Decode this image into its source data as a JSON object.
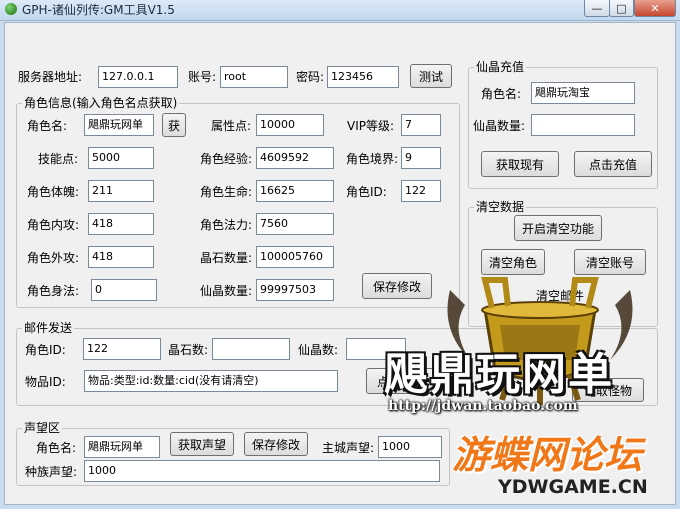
{
  "window": {
    "title": "GPH-诸仙列传:GM工具V1.5",
    "min": "—",
    "max": "□",
    "close": "✕"
  },
  "server": {
    "addr_label": "服务器地址:",
    "addr_value": "127.0.0.1",
    "account_label": "账号:",
    "account_value": "root",
    "password_label": "密码:",
    "password_value": "123456",
    "test_button": "测试"
  },
  "role": {
    "group_title": "角色信息(输入角色名点获取)",
    "name_label": "角色名:",
    "name_value": "飓鼎玩网单",
    "get_button": "获",
    "attr_label": "属性点:",
    "attr_value": "10000",
    "vip_label": "VIP等级:",
    "vip_value": "7",
    "skill_label": "技能点:",
    "skill_value": "5000",
    "exp_label": "角色经验:",
    "exp_value": "4609592",
    "realm_label": "角色境界:",
    "realm_value": "9",
    "physique_label": "角色体魄:",
    "physique_value": "211",
    "hp_label": "角色生命:",
    "hp_value": "16625",
    "id_label": "角色ID:",
    "id_value": "122",
    "inner_label": "角色内攻:",
    "inner_value": "418",
    "mana_label": "角色法力:",
    "mana_value": "7560",
    "outer_label": "角色外攻:",
    "outer_value": "418",
    "crystal_label": "晶石数量:",
    "crystal_value": "100005760",
    "agility_label": "角色身法:",
    "agility_value": "0",
    "xianjing_label": "仙晶数量:",
    "xianjing_value": "99997503",
    "save_button": "保存修改"
  },
  "recharge": {
    "group_title": "仙晶充值",
    "name_label": "角色名:",
    "name_value": "飓鼎玩淘宝",
    "amount_label": "仙晶数量:",
    "amount_value": "",
    "fetch_button": "获取现有",
    "recharge_button": "点击充值"
  },
  "clear": {
    "group_title": "清空数据",
    "enable_button": "开启清空功能",
    "clear_role_button": "清空角色",
    "clear_account_button": "清空账号",
    "clear_mail_label": "清空邮件"
  },
  "mail": {
    "group_title": "邮件发送",
    "role_id_label": "角色ID:",
    "role_id_value": "122",
    "crystal_label": "晶石数:",
    "crystal_value": "",
    "xianjing_label": "仙晶数:",
    "xianjing_value": "",
    "item_label": "物品ID:",
    "item_value": "物品:类型:id:数量:cid(没有请清空)",
    "send_button": "点击发送",
    "read_button": "读取怪物"
  },
  "reputation": {
    "group_title": "声望区",
    "name_label": "角色名:",
    "name_value": "飓鼎玩网单",
    "fetch_button": "获取声望",
    "save_button": "保存修改",
    "city_label": "主城声望:",
    "city_value": "1000",
    "race_label": "种族声望:",
    "race_value": "1000"
  },
  "watermark": {
    "url": "http://jdwan.taobao.com",
    "brand": "飓鼎玩网单",
    "forum": "游蝶网论坛",
    "site": "YDWGAME.CN"
  },
  "colors": {
    "background": "#c9dcef",
    "panel": "#f0f0f0",
    "forum_text": "#f07818",
    "brand_text": "#111111"
  }
}
